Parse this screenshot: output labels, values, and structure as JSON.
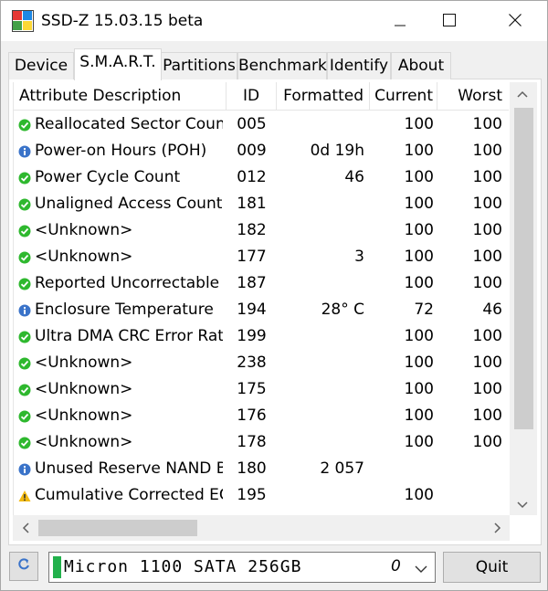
{
  "window": {
    "title": "SSD-Z 15.03.15 beta",
    "controls": {
      "minimize": "—",
      "maximize": "☐",
      "close": "✕"
    }
  },
  "tabs": [
    {
      "label": "Device",
      "active": false
    },
    {
      "label": "S.M.A.R.T.",
      "active": true
    },
    {
      "label": "Partitions",
      "active": false
    },
    {
      "label": "Benchmark",
      "active": false
    },
    {
      "label": "Identify",
      "active": false
    },
    {
      "label": "About",
      "active": false
    }
  ],
  "smart_table": {
    "columns": [
      "Attribute Description",
      "ID",
      "Formatted",
      "Current",
      "Worst"
    ],
    "rows": [
      {
        "status": "ok",
        "desc": "Reallocated Sector Count",
        "id": "005",
        "formatted": "",
        "current": "100",
        "worst": "100"
      },
      {
        "status": "info",
        "desc": "Power-on Hours (POH)",
        "id": "009",
        "formatted": "0d 19h",
        "current": "100",
        "worst": "100"
      },
      {
        "status": "ok",
        "desc": "Power Cycle Count",
        "id": "012",
        "formatted": "46",
        "current": "100",
        "worst": "100"
      },
      {
        "status": "ok",
        "desc": "Unaligned Access Count",
        "id": "181",
        "formatted": "",
        "current": "100",
        "worst": "100"
      },
      {
        "status": "ok",
        "desc": "<Unknown>",
        "id": "182",
        "formatted": "",
        "current": "100",
        "worst": "100"
      },
      {
        "status": "ok",
        "desc": "<Unknown>",
        "id": "177",
        "formatted": "3",
        "current": "100",
        "worst": "100"
      },
      {
        "status": "ok",
        "desc": "Reported Uncorrectable ...",
        "id": "187",
        "formatted": "",
        "current": "100",
        "worst": "100"
      },
      {
        "status": "info",
        "desc": "Enclosure Temperature",
        "id": "194",
        "formatted": "28° C",
        "current": "72",
        "worst": "46"
      },
      {
        "status": "ok",
        "desc": "Ultra DMA CRC Error Rate",
        "id": "199",
        "formatted": "",
        "current": "100",
        "worst": "100"
      },
      {
        "status": "ok",
        "desc": "<Unknown>",
        "id": "238",
        "formatted": "",
        "current": "100",
        "worst": "100"
      },
      {
        "status": "ok",
        "desc": "<Unknown>",
        "id": "175",
        "formatted": "",
        "current": "100",
        "worst": "100"
      },
      {
        "status": "ok",
        "desc": "<Unknown>",
        "id": "176",
        "formatted": "",
        "current": "100",
        "worst": "100"
      },
      {
        "status": "ok",
        "desc": "<Unknown>",
        "id": "178",
        "formatted": "",
        "current": "100",
        "worst": "100"
      },
      {
        "status": "info",
        "desc": "Unused Reserve NAND B...",
        "id": "180",
        "formatted": "2 057",
        "current": "",
        "worst": ""
      },
      {
        "status": "warn",
        "desc": "Cumulative Corrected ECC",
        "id": "195",
        "formatted": "",
        "current": "100",
        "worst": ""
      }
    ]
  },
  "drive_selector": {
    "name": "Micron 1100 SATA 256GB",
    "index": "0"
  },
  "buttons": {
    "quit": "Quit"
  },
  "icons": {
    "ok": "green-check-circle-icon",
    "info": "blue-info-circle-icon",
    "warn": "yellow-warning-triangle-icon",
    "refresh": "refresh-icon"
  },
  "colors": {
    "ok": "#2eb82e",
    "info": "#3a73c9",
    "warn": "#f2b90f",
    "drive_bar": "#22b14c"
  }
}
